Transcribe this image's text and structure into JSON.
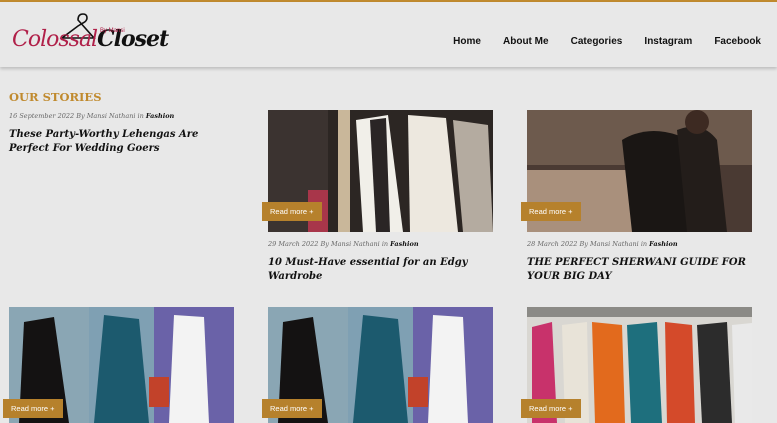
{
  "logo": {
    "word1": "Colossal",
    "word2": "Closet",
    "tagline": "By Mansi"
  },
  "nav": [
    "Home",
    "About Me",
    "Categories",
    "Instagram",
    "Facebook"
  ],
  "section_title": "OUR STORIES",
  "read_more": "Read more +",
  "posts": [
    {
      "date": "16 September 2022",
      "by": "By",
      "author": "Mansi Nathani",
      "in": "in",
      "category": "Fashion",
      "title": "These Party-Worthy Lehengas Are Perfect For Wedding Goers"
    },
    {
      "date": "29 March 2022",
      "by": "By",
      "author": "Mansi Nathani",
      "in": "in",
      "category": "Fashion",
      "title": "10 Must-Have essential for an Edgy Wardrobe"
    },
    {
      "date": "28 March 2022",
      "by": "By",
      "author": "Mansi Nathani",
      "in": "in",
      "category": "Fashion",
      "title": "THE PERFECT SHERWANI GUIDE FOR YOUR BIG DAY"
    }
  ],
  "colors": {
    "accent": "#c08a2e",
    "button": "#b6812c",
    "brand": "#b02049",
    "background": "#e8e8e8"
  }
}
